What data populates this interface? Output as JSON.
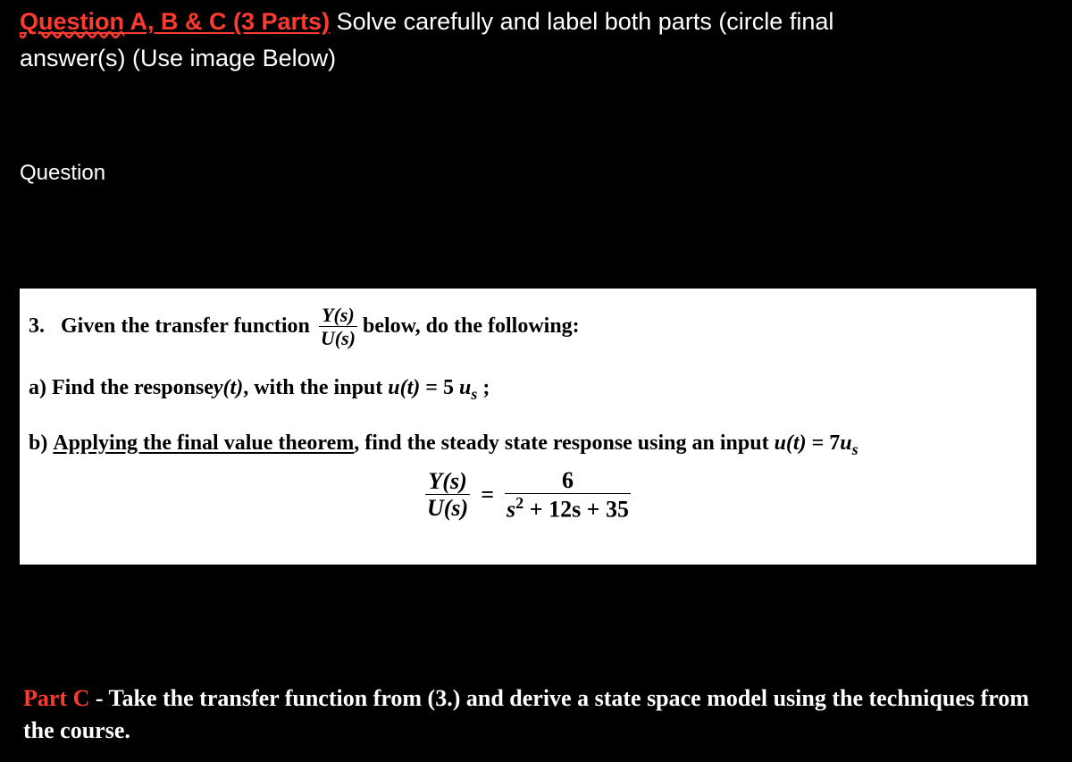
{
  "header": {
    "title_wavy": "Question",
    "title_rest": " A, B  & C  (3 Parts)",
    "instruction_1": " Solve carefully and label both parts (circle final",
    "instruction_2": "answer(s) (Use image Below)"
  },
  "question_heading": "Question",
  "problem": {
    "intro_prefix": "3.   Given the transfer function ",
    "frac_num": "Y(s)",
    "frac_den": "U(s)",
    "intro_suffix": " below, do the following:",
    "part_a_prefix": "a) Find the response ",
    "y_of_t": "y(t)",
    "part_a_mid": ", with the input ",
    "u_of_t": "u(t)",
    "eq": " = ",
    "five_us_5": "5 ",
    "five_us_u": "u",
    "five_us_s": "s",
    "part_a_end": " ;",
    "part_b_prefix": "b) ",
    "part_b_underlined": "Applying the final value theorem",
    "part_b_mid": ", find the steady state response using an input ",
    "seven_us_7": "7",
    "seven_us_u": "u",
    "seven_us_s": "s",
    "transfer": {
      "lhs_num": "Y(s)",
      "lhs_den": "U(s)",
      "equals": "=",
      "rhs_num": "6",
      "rhs_den_s": "s",
      "rhs_den_rest": " + 12s + 35"
    }
  },
  "part_c": {
    "label": "Part C",
    "text": " - Take the transfer function from (3.)  and derive a state space model using the techniques from the course."
  }
}
